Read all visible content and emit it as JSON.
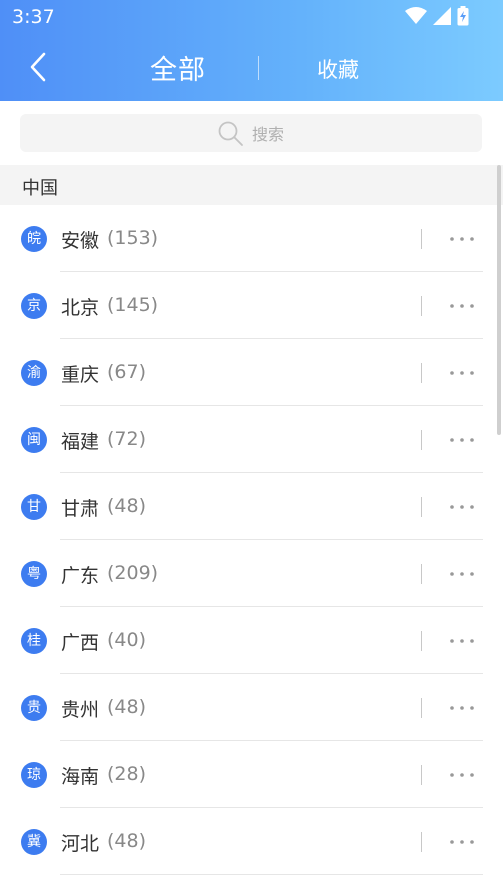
{
  "status_bar": {
    "time": "3:37"
  },
  "header": {
    "title": "全部",
    "favorites_tab": "收藏"
  },
  "search": {
    "placeholder": "搜索"
  },
  "section": {
    "label": "中国"
  },
  "provinces": [
    {
      "abbr": "皖",
      "name": "安徽",
      "count": "(153)"
    },
    {
      "abbr": "京",
      "name": "北京",
      "count": "(145)"
    },
    {
      "abbr": "渝",
      "name": "重庆",
      "count": "(67)"
    },
    {
      "abbr": "闽",
      "name": "福建",
      "count": "(72)"
    },
    {
      "abbr": "甘",
      "name": "甘肃",
      "count": "(48)"
    },
    {
      "abbr": "粤",
      "name": "广东",
      "count": "(209)"
    },
    {
      "abbr": "桂",
      "name": "广西",
      "count": "(40)"
    },
    {
      "abbr": "贵",
      "name": "贵州",
      "count": "(48)"
    },
    {
      "abbr": "琼",
      "name": "海南",
      "count": "(28)"
    },
    {
      "abbr": "冀",
      "name": "河北",
      "count": "(48)"
    }
  ],
  "icons": {
    "back": "chevron-left-icon",
    "wifi": "wifi-icon",
    "signal": "signal-icon",
    "battery": "battery-charging-icon",
    "search": "search-icon",
    "more": "more-horizontal-icon"
  },
  "colors": {
    "header_start": "#4f8ff7",
    "header_end": "#7ccbff",
    "badge": "#3d7cf0",
    "count_text": "#888888"
  }
}
